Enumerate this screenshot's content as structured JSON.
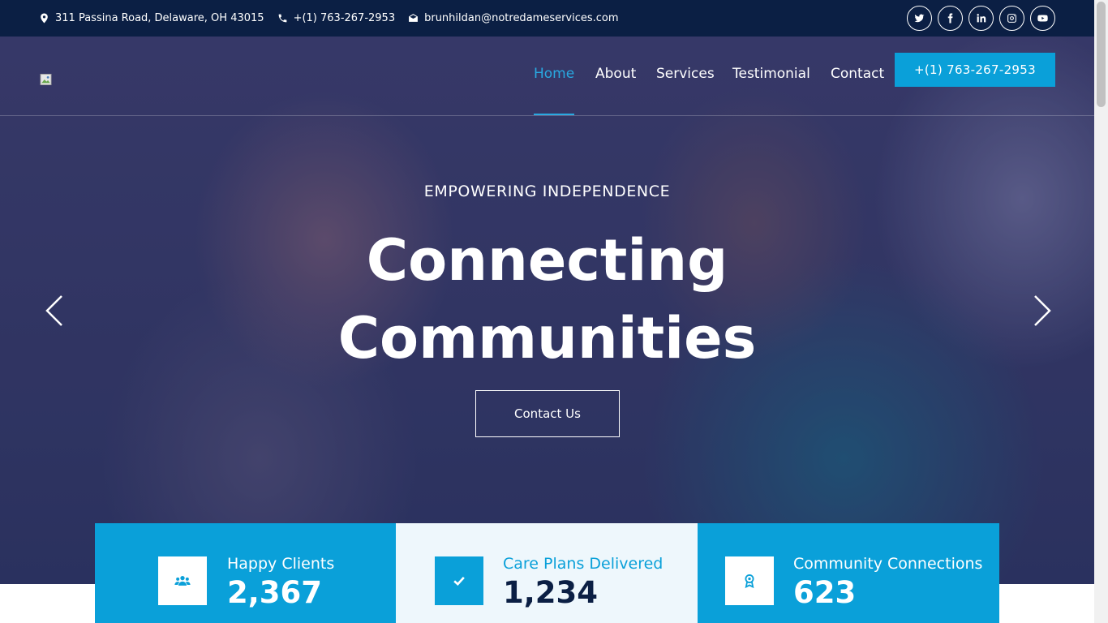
{
  "topbar": {
    "address": "311 Passina Road, Delaware, OH 43015",
    "phone": "+(1) 763-267-2953",
    "email": "brunhildan@notredameservices.com",
    "socials": [
      "twitter-icon",
      "facebook-icon",
      "linkedin-icon",
      "instagram-icon",
      "youtube-icon"
    ]
  },
  "nav": {
    "items": [
      {
        "label": "Home",
        "active": true
      },
      {
        "label": "About"
      },
      {
        "label": "Services"
      },
      {
        "label": "Testimonial"
      },
      {
        "label": "Contact"
      }
    ],
    "call_button": "+(1) 763-267-2953"
  },
  "hero": {
    "kicker": "EMPOWERING INDEPENDENCE",
    "headline_line1": "Connecting",
    "headline_line2": "Communities",
    "cta": "Contact Us"
  },
  "stats": [
    {
      "label": "Happy Clients",
      "value": "2,367",
      "icon": "users-icon"
    },
    {
      "label": "Care Plans Delivered",
      "value": "1,234",
      "icon": "check-icon"
    },
    {
      "label": "Community Connections",
      "value": "623",
      "icon": "award-icon"
    }
  ],
  "colors": {
    "accent": "#0aa0d9",
    "topbar": "#0b1f44",
    "active_nav": "#29a9e1"
  }
}
